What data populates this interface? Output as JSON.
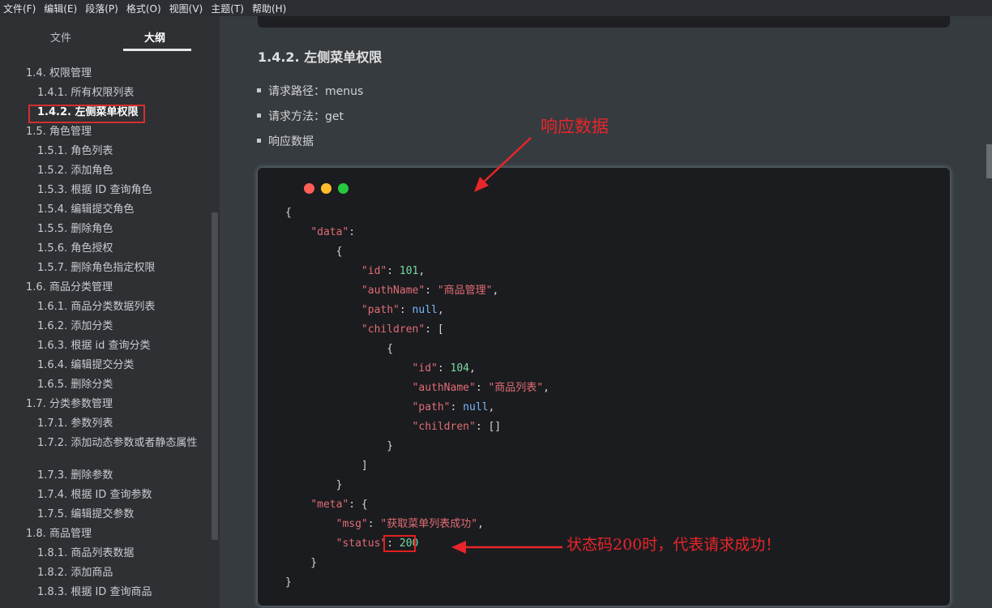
{
  "menubar": [
    "文件(F)",
    "编辑(E)",
    "段落(P)",
    "格式(O)",
    "视图(V)",
    "主题(T)",
    "帮助(H)"
  ],
  "sidebar": {
    "tab_files": "文件",
    "tab_outline": "大纲",
    "items": [
      {
        "label": "1.4. 权限管理",
        "level": 1
      },
      {
        "label": "1.4.1. 所有权限列表",
        "level": 2
      },
      {
        "label": "1.4.2. 左侧菜单权限",
        "level": 2,
        "active": true
      },
      {
        "label": "1.5. 角色管理",
        "level": 1
      },
      {
        "label": "1.5.1. 角色列表",
        "level": 2
      },
      {
        "label": "1.5.2. 添加角色",
        "level": 2
      },
      {
        "label": "1.5.3. 根据 ID 查询角色",
        "level": 2
      },
      {
        "label": "1.5.4. 编辑提交角色",
        "level": 2
      },
      {
        "label": "1.5.5. 删除角色",
        "level": 2
      },
      {
        "label": "1.5.6. 角色授权",
        "level": 2
      },
      {
        "label": "1.5.7. 删除角色指定权限",
        "level": 2
      },
      {
        "label": "1.6. 商品分类管理",
        "level": 1
      },
      {
        "label": "1.6.1. 商品分类数据列表",
        "level": 2
      },
      {
        "label": "1.6.2. 添加分类",
        "level": 2
      },
      {
        "label": "1.6.3. 根据 id 查询分类",
        "level": 2
      },
      {
        "label": "1.6.4. 编辑提交分类",
        "level": 2
      },
      {
        "label": "1.6.5. 删除分类",
        "level": 2
      },
      {
        "label": "1.7. 分类参数管理",
        "level": 1
      },
      {
        "label": "1.7.1. 参数列表",
        "level": 2
      },
      {
        "label": "1.7.2. 添加动态参数或者静态属性",
        "level": 2,
        "multiline": true
      },
      {
        "label": "1.7.3. 删除参数",
        "level": 2
      },
      {
        "label": "1.7.4. 根据 ID 查询参数",
        "level": 2
      },
      {
        "label": "1.7.5. 编辑提交参数",
        "level": 2
      },
      {
        "label": "1.8. 商品管理",
        "level": 1
      },
      {
        "label": "1.8.1. 商品列表数据",
        "level": 2
      },
      {
        "label": "1.8.2. 添加商品",
        "level": 2
      },
      {
        "label": "1.8.3. 根据 ID 查询商品",
        "level": 2
      }
    ]
  },
  "main": {
    "heading": "1.4.2. 左侧菜单权限",
    "bullets": [
      "请求路径：menus",
      "请求方法：get",
      "响应数据"
    ],
    "code": [
      [
        [
          "{",
          "punc"
        ]
      ],
      [
        [
          "    ",
          "punc"
        ],
        [
          "\"data\"",
          "key"
        ],
        [
          ":",
          "punc"
        ]
      ],
      [
        [
          "        {",
          "punc"
        ]
      ],
      [
        [
          "            ",
          "punc"
        ],
        [
          "\"id\"",
          "key"
        ],
        [
          ": ",
          "punc"
        ],
        [
          "101",
          "num"
        ],
        [
          ",",
          "punc"
        ]
      ],
      [
        [
          "            ",
          "punc"
        ],
        [
          "\"authName\"",
          "key"
        ],
        [
          ": ",
          "punc"
        ],
        [
          "\"商品管理\"",
          "str"
        ],
        [
          ",",
          "punc"
        ]
      ],
      [
        [
          "            ",
          "punc"
        ],
        [
          "\"path\"",
          "key"
        ],
        [
          ": ",
          "punc"
        ],
        [
          "null",
          "kw"
        ],
        [
          ",",
          "punc"
        ]
      ],
      [
        [
          "            ",
          "punc"
        ],
        [
          "\"children\"",
          "key"
        ],
        [
          ": [",
          "punc"
        ]
      ],
      [
        [
          "                {",
          "punc"
        ]
      ],
      [
        [
          "                    ",
          "punc"
        ],
        [
          "\"id\"",
          "key"
        ],
        [
          ": ",
          "punc"
        ],
        [
          "104",
          "num"
        ],
        [
          ",",
          "punc"
        ]
      ],
      [
        [
          "                    ",
          "punc"
        ],
        [
          "\"authName\"",
          "key"
        ],
        [
          ": ",
          "punc"
        ],
        [
          "\"商品列表\"",
          "str"
        ],
        [
          ",",
          "punc"
        ]
      ],
      [
        [
          "                    ",
          "punc"
        ],
        [
          "\"path\"",
          "key"
        ],
        [
          ": ",
          "punc"
        ],
        [
          "null",
          "kw"
        ],
        [
          ",",
          "punc"
        ]
      ],
      [
        [
          "                    ",
          "punc"
        ],
        [
          "\"children\"",
          "key"
        ],
        [
          ": []",
          "punc"
        ]
      ],
      [
        [
          "                }",
          "punc"
        ]
      ],
      [
        [
          "            ]",
          "punc"
        ]
      ],
      [
        [
          "        }",
          "punc"
        ]
      ],
      [
        [
          "    ",
          "punc"
        ],
        [
          "\"meta\"",
          "key"
        ],
        [
          ": {",
          "punc"
        ]
      ],
      [
        [
          "        ",
          "punc"
        ],
        [
          "\"msg\"",
          "key"
        ],
        [
          ": ",
          "punc"
        ],
        [
          "\"获取菜单列表成功\"",
          "str"
        ],
        [
          ",",
          "punc"
        ]
      ],
      [
        [
          "        ",
          "punc"
        ],
        [
          "\"status\"",
          "key"
        ],
        [
          ": ",
          "punc"
        ],
        [
          "200",
          "num"
        ]
      ],
      [
        [
          "    }",
          "punc"
        ]
      ],
      [
        [
          "}",
          "punc"
        ]
      ]
    ]
  },
  "annotations": {
    "response_label": "响应数据",
    "status_note": "状态码200时，代表请求成功！"
  },
  "colors": {
    "annotation_red": "#e8252a",
    "code_bg": "#1b1c1f",
    "key": "#e06c75",
    "number": "#78d8a4",
    "keyword": "#79b8ff"
  }
}
